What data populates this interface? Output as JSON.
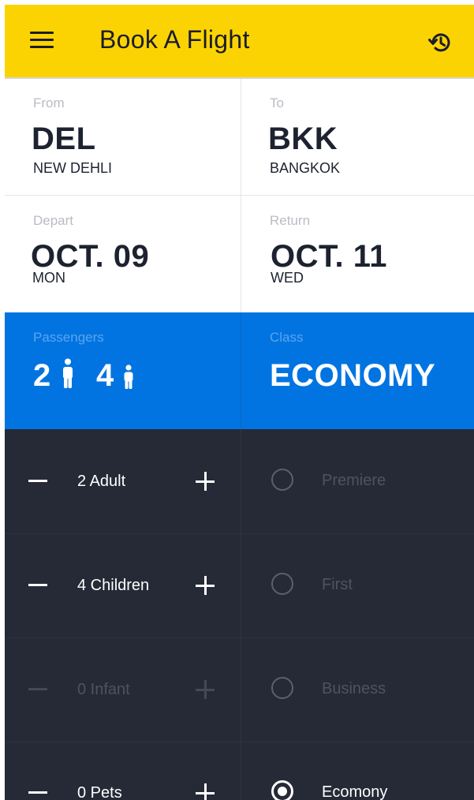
{
  "header": {
    "title": "Book A Flight",
    "background": "#fcd302",
    "menu_icon": "hamburger-menu-icon",
    "history_icon": "history-icon"
  },
  "route": {
    "from_label": "From",
    "from_code": "DEL",
    "from_city": "NEW DEHLI",
    "to_label": "To",
    "to_code": "BKK",
    "to_city": "BANGKOK"
  },
  "dates": {
    "depart_label": "Depart",
    "depart_date": "OCT. 09",
    "depart_day": "MON",
    "return_label": "Return",
    "return_date": "OCT. 11",
    "return_day": "WED"
  },
  "summary": {
    "background": "#0174e1",
    "passengers_label": "Passengers",
    "adult_count": "2",
    "adult_icon": "adult-person-icon",
    "child_count": "4",
    "child_icon": "child-person-icon",
    "class_label": "Class",
    "class_value": "ECONOMY"
  },
  "passenger_rows": [
    {
      "label": "2 Adult",
      "enabled": true
    },
    {
      "label": "4 Children",
      "enabled": true
    },
    {
      "label": "0 Infant",
      "enabled": false
    },
    {
      "label": "0 Pets",
      "enabled": true
    }
  ],
  "class_options": [
    {
      "label": "Premiere",
      "selected": false
    },
    {
      "label": "First",
      "selected": false
    },
    {
      "label": "Business",
      "selected": false
    },
    {
      "label": "Ecomony",
      "selected": true
    }
  ],
  "colors": {
    "dark_panel": "#252a36",
    "accent_blue": "#0174e1",
    "accent_yellow": "#fcd302"
  }
}
